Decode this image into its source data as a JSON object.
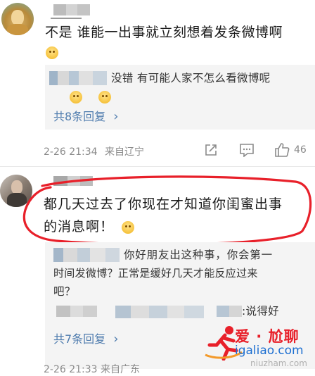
{
  "comment1": {
    "text": "不是 谁能一出事就立刻想着发条微博啊",
    "reply": {
      "text": "没错 有可能人家不怎么看微博呢",
      "more": "共8条回复",
      "more_chevron": "›"
    },
    "meta": {
      "time": "2-26 21:34",
      "location": "来自辽宁",
      "likes": "46"
    }
  },
  "comment2": {
    "text_line1": "都几天过去了你现在才知道你闺蜜出事",
    "text_line2": "的消息啊！",
    "reply1": {
      "line1": "你好朋友出这种事，你会第一",
      "line2": "时间发微博？正常是缓好几天才能反应过来",
      "line3": "吧？"
    },
    "reply2_tail": ":说得好",
    "more": "共7条回复",
    "more_chevron": "›",
    "meta_partial": "2-26 21:33  来自广东"
  },
  "watermark": {
    "brand": "爱 · 尬聊",
    "url": "igaliao.com",
    "url2": "niuzham.com"
  }
}
